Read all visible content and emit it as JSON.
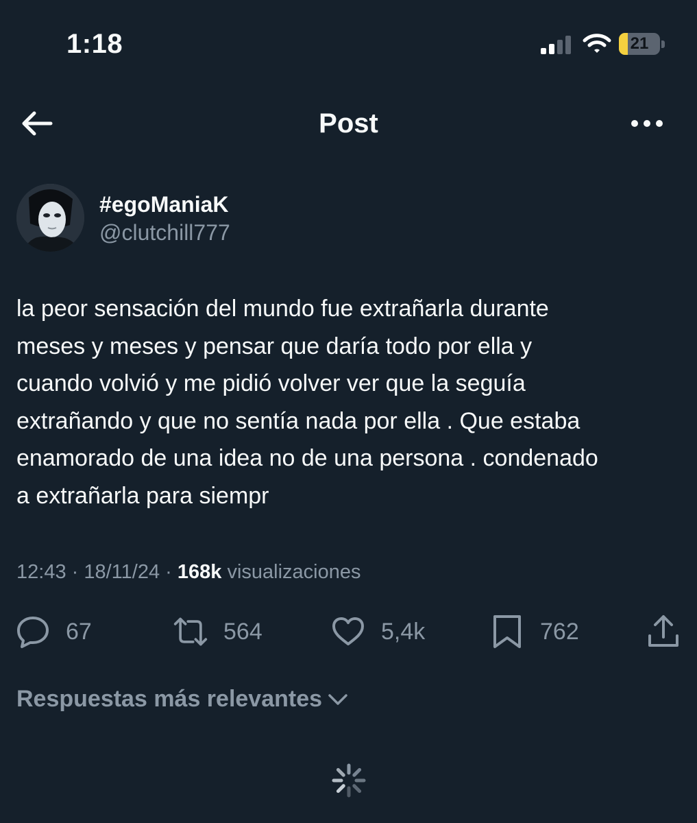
{
  "status_bar": {
    "time": "1:18",
    "battery": "21"
  },
  "header": {
    "title": "Post"
  },
  "author": {
    "display_name": "#egoManiaK",
    "handle": "@clutchill777"
  },
  "tweet": {
    "text": "la peor sensación del mundo fue extrañarla durante\nmeses y meses y pensar que daría todo por ella y\ncuando volvió y me pidió volver ver que la seguía\nextrañando y que no sentía nada por ella . Que estaba\nenamorado de una idea no de una persona . condenado\na extrañarla para siempr",
    "time": "12:43",
    "date": "18/11/24",
    "views": "168k",
    "views_label": "visualizaciones"
  },
  "actions": {
    "replies": "67",
    "reposts": "564",
    "likes": "5,4k",
    "bookmarks": "762"
  },
  "replies_sort": {
    "label": "Respuestas más relevantes"
  },
  "colors": {
    "background": "#15202b",
    "text": "#f7f9f9",
    "secondary": "#8b98a5",
    "battery": "#f4d03f"
  }
}
